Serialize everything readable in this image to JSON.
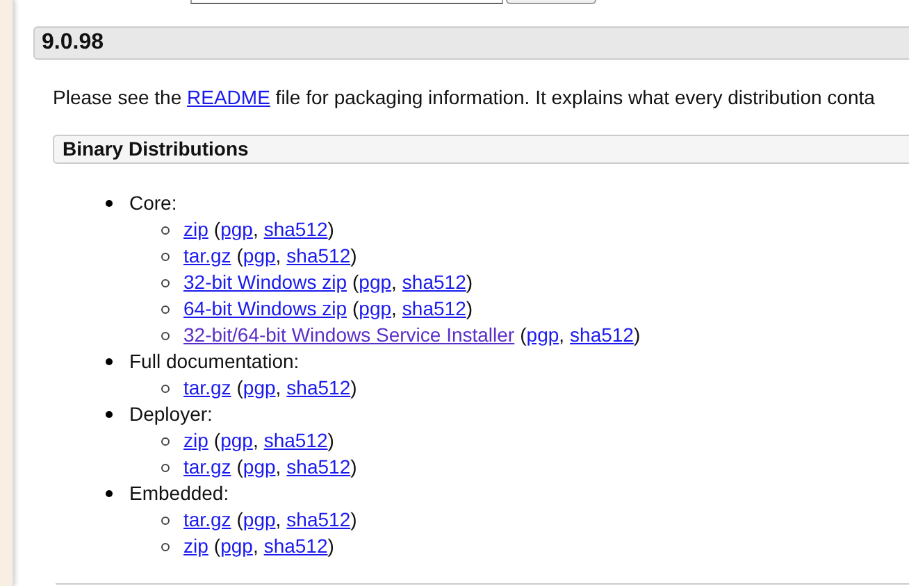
{
  "release": {
    "version": "9.0.98",
    "intro": {
      "before": "Please see the",
      "link": "README",
      "after": "file for packaging information. It explains what every distribution conta"
    }
  },
  "section": {
    "title": "Binary Distributions"
  },
  "distributions": [
    {
      "name": "Core:",
      "files": [
        {
          "label": "zip",
          "visited": false,
          "open": "(",
          "pgp": "pgp",
          "comma": ",",
          "sha": "sha512",
          "close": ")"
        },
        {
          "label": "tar.gz",
          "visited": false,
          "open": "(",
          "pgp": "pgp",
          "comma": ",",
          "sha": "sha512",
          "close": ")"
        },
        {
          "label": "32-bit Windows zip",
          "visited": false,
          "open": "(",
          "pgp": "pgp",
          "comma": ",",
          "sha": "sha512",
          "close": ")"
        },
        {
          "label": "64-bit Windows zip",
          "visited": false,
          "open": "(",
          "pgp": "pgp",
          "comma": ",",
          "sha": "sha512",
          "close": ")"
        },
        {
          "label": "32-bit/64-bit Windows Service Installer",
          "visited": true,
          "open": "(",
          "pgp": "pgp",
          "comma": ",",
          "sha": "sha512",
          "close": ")"
        }
      ]
    },
    {
      "name": "Full documentation:",
      "files": [
        {
          "label": "tar.gz",
          "visited": false,
          "open": "(",
          "pgp": "pgp",
          "comma": ",",
          "sha": "sha512",
          "close": ")"
        }
      ]
    },
    {
      "name": "Deployer:",
      "files": [
        {
          "label": "zip",
          "visited": false,
          "open": "(",
          "pgp": "pgp",
          "comma": ",",
          "sha": "sha512",
          "close": ")"
        },
        {
          "label": "tar.gz",
          "visited": false,
          "open": "(",
          "pgp": "pgp",
          "comma": ",",
          "sha": "sha512",
          "close": ")"
        }
      ]
    },
    {
      "name": "Embedded:",
      "files": [
        {
          "label": "tar.gz",
          "visited": false,
          "open": "(",
          "pgp": "pgp",
          "comma": ",",
          "sha": "sha512",
          "close": ")"
        },
        {
          "label": "zip",
          "visited": false,
          "open": "(",
          "pgp": "pgp",
          "comma": ",",
          "sha": "sha512",
          "close": ")"
        }
      ]
    }
  ]
}
